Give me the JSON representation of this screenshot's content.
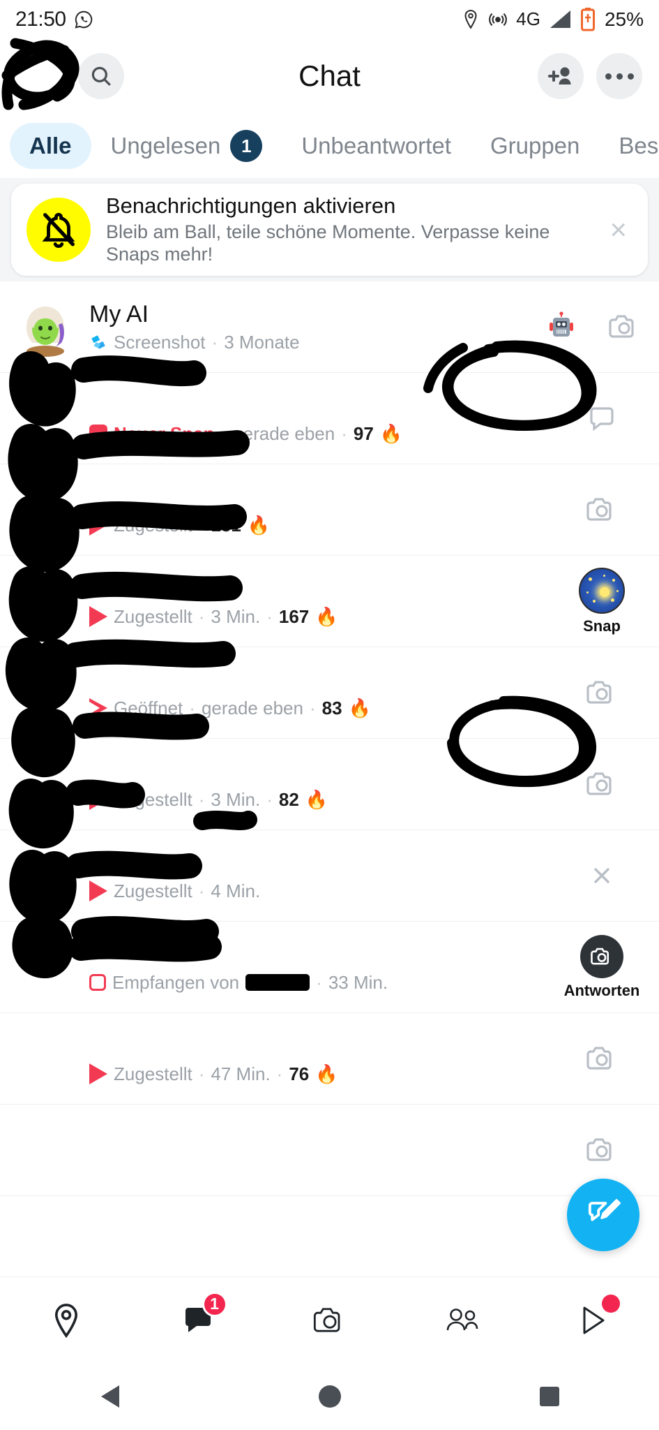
{
  "statusbar": {
    "time": "21:50",
    "whatsapp_icon": "whatsapp-icon",
    "location_icon": "location-pin-icon",
    "hotspot_icon": "hotspot-icon",
    "network": "4G",
    "signal_icon": "signal-bars-icon",
    "battery_icon": "battery-low-icon",
    "battery": "25%",
    "battery_color": "#f0662b"
  },
  "header": {
    "title": "Chat",
    "avatar_name": "profile-avatar",
    "search_icon": "search-icon",
    "add_friend_icon": "add-friend-icon",
    "more_icon": "more-options-icon"
  },
  "tabs": {
    "items": [
      {
        "label": "Alle",
        "active": true,
        "badge": ""
      },
      {
        "label": "Ungelesen",
        "active": false,
        "badge": "1"
      },
      {
        "label": "Unbeantwortet",
        "active": false,
        "badge": ""
      },
      {
        "label": "Gruppen",
        "active": false,
        "badge": ""
      },
      {
        "label": "Bes",
        "active": false,
        "badge": ""
      }
    ],
    "active_bg": "#e3f3fd",
    "active_fg": "#15344f",
    "badge_bg": "#17405f"
  },
  "banner": {
    "icon": "bell-muted-icon",
    "icon_bg": "#fffc00",
    "title": "Benachrichtigungen aktivieren",
    "subtitle": "Bleib am Ball, teile schöne Momente. Verpasse keine Snaps mehr!",
    "close_icon": "close-icon",
    "close_label": "×"
  },
  "chat_list": {
    "rows": [
      {
        "name": "My AI",
        "name_redacted": false,
        "avatar": "my-ai-bitmoji-avatar",
        "status_glyph": "screenshot-icon",
        "status_label": "Screenshot",
        "time": "3 Monate",
        "streak": "",
        "right_icon": "robot-emoji",
        "right_icon_2": "camera-icon",
        "right_label": ""
      },
      {
        "name": "",
        "name_redacted": true,
        "avatar": "friend-avatar-redacted",
        "status_glyph": "new-snap-square-filled",
        "status_label": "Neuer Snap",
        "status_is_new": true,
        "time": "gerade eben",
        "streak": "97",
        "streak_emoji": "🔥",
        "right_icon": "chat-bubble-icon",
        "right_label": "",
        "annotated": "circled"
      },
      {
        "name": "",
        "name_redacted": true,
        "avatar": "friend-avatar-redacted",
        "status_glyph": "sent-triangle-filled",
        "status_label": "Zugestellt",
        "time": "",
        "streak": "151",
        "streak_emoji": "🔥",
        "right_icon": "camera-icon",
        "right_label": ""
      },
      {
        "name": "",
        "name_redacted": true,
        "avatar": "friend-avatar-redacted",
        "status_glyph": "sent-triangle-filled",
        "status_label": "Zugestellt",
        "time": "3 Min.",
        "streak": "167",
        "streak_emoji": "🔥",
        "right_icon": "snap-story-circle",
        "right_label": "Snap"
      },
      {
        "name": "",
        "name_redacted": true,
        "avatar": "friend-avatar-redacted",
        "status_glyph": "opened-triangle-outline",
        "status_label": "Geöffnet",
        "time": "gerade eben",
        "streak": "83",
        "streak_emoji": "🔥",
        "right_icon": "camera-icon",
        "right_label": ""
      },
      {
        "name": "",
        "name_redacted": true,
        "avatar": "friend-avatar-redacted",
        "status_glyph": "sent-triangle-filled",
        "status_label": "Zugestellt",
        "time": "3 Min.",
        "streak": "82",
        "streak_emoji": "🔥",
        "right_icon": "camera-icon",
        "right_label": ""
      },
      {
        "name": "",
        "name_redacted": true,
        "avatar": "friend-avatar-redacted",
        "status_glyph": "sent-triangle-filled",
        "status_label": "Zugestellt",
        "time": "4 Min.",
        "streak": "",
        "streak_emoji": "",
        "right_icon": "close-icon",
        "right_label": "",
        "annotated": "circled"
      },
      {
        "name": "",
        "name_redacted": true,
        "avatar": "friend-avatar-redacted",
        "status_glyph": "received-square-outline",
        "status_label": "Empfangen von",
        "status_name_redacted": true,
        "time": "33 Min.",
        "streak": "",
        "streak_emoji": "",
        "right_icon": "reply-camera-icon",
        "right_label": "Antworten"
      },
      {
        "name": "",
        "name_redacted": true,
        "avatar": "friend-avatar-redacted",
        "status_glyph": "sent-triangle-filled",
        "status_label": "Zugestellt",
        "time": "47 Min.",
        "streak": "76",
        "streak_emoji": "🔥",
        "right_icon": "camera-icon",
        "right_label": ""
      },
      {
        "name": "",
        "name_redacted": true,
        "avatar": "friend-avatar-redacted",
        "status_glyph": "",
        "status_label": "",
        "time": "",
        "streak": "",
        "streak_emoji": "",
        "right_icon": "camera-icon",
        "right_label": ""
      }
    ]
  },
  "fab": {
    "icon": "new-chat-icon",
    "color": "#12b2f3"
  },
  "bottom_nav": {
    "items": [
      {
        "icon": "map-pin-icon",
        "badge": "",
        "dot": false
      },
      {
        "icon": "chat-icon",
        "badge": "1",
        "dot": false,
        "active": true
      },
      {
        "icon": "camera-icon",
        "badge": "",
        "dot": false
      },
      {
        "icon": "friends-icon",
        "badge": "",
        "dot": false
      },
      {
        "icon": "spotlight-play-icon",
        "badge": "",
        "dot": true
      }
    ],
    "badge_color": "#f2264e"
  },
  "system_nav": {
    "back_icon": "android-back-icon",
    "home_icon": "android-home-icon",
    "recents_icon": "android-recents-icon"
  },
  "annotations": {
    "marker_color": "#000000",
    "note": "hand-drawn black marker redactions over avatars, names and three circled UI targets"
  }
}
